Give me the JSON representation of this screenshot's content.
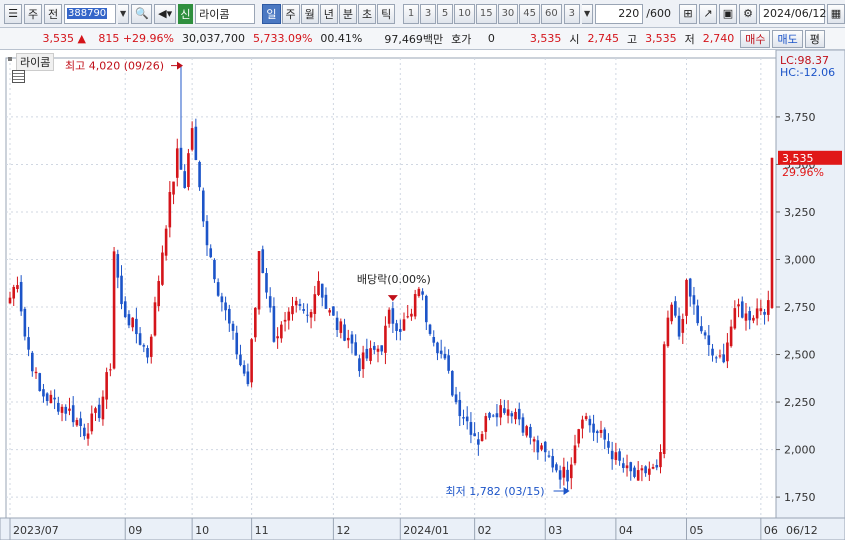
{
  "toolbar": {
    "type_label": "주",
    "mode_label": "전",
    "code": "388790",
    "shin_label": "신",
    "name": "라이콤",
    "periods": [
      "일",
      "주",
      "월",
      "년",
      "분",
      "초",
      "틱"
    ],
    "active_period": "일",
    "intervals": [
      "1",
      "3",
      "5",
      "10",
      "15",
      "30",
      "45",
      "60"
    ],
    "interval_select": "3",
    "count": "220",
    "count_total": "/600",
    "date": "2024/06/12"
  },
  "quote": {
    "price": "3,535",
    "change": "815",
    "change_pct": "+29.96%",
    "volume": "30,037,700",
    "volume_pct": "5,733.09%",
    "turnover": "00.41%",
    "amount": "97,469백만",
    "hoga_label": "호가",
    "hoga_value": "0",
    "hoga_price": "3,535",
    "open_label": "시",
    "open": "2,745",
    "high_label": "고",
    "high": "3,535",
    "low_label": "저",
    "low": "2,740",
    "buy_label": "매수",
    "sell_label": "매도",
    "eval_label": "평"
  },
  "chart_title": "라이콤",
  "chart_data": {
    "type": "candlestick",
    "colors": {
      "up": "#d4141a",
      "down": "#1c54c8",
      "grid": "#d0d7e2",
      "axis_bg": "#eaf0f8"
    },
    "y_ticks": [
      1750,
      2000,
      2250,
      2500,
      2750,
      3000,
      3250,
      3500,
      3750
    ],
    "y_tick_labels": [
      "1,750",
      "2,000",
      "2,250",
      "2,500",
      "2,750",
      "3,000",
      "3,250",
      "3,500",
      "3,750"
    ],
    "ylim": [
      1640,
      4060
    ],
    "x_ticks": [
      {
        "label": "2023/07",
        "index": 0
      },
      {
        "label": "09",
        "index": 31
      },
      {
        "label": "10",
        "index": 49
      },
      {
        "label": "11",
        "index": 65
      },
      {
        "label": "12",
        "index": 87
      },
      {
        "label": "2024/01",
        "index": 105
      },
      {
        "label": "02",
        "index": 125
      },
      {
        "label": "03",
        "index": 144
      },
      {
        "label": "04",
        "index": 163
      },
      {
        "label": "05",
        "index": 182
      },
      {
        "label": "06",
        "index": 202
      }
    ],
    "axis_date_label": "06/12",
    "last_price_label": "3,535",
    "last_pct_label": "29.96%",
    "lc_label": "LC:98.37",
    "hc_label": "HC:-12.06",
    "annotations": {
      "high": {
        "text": "최고 4,020 (09/26)",
        "index": 46,
        "value": 4020
      },
      "low": {
        "text": "최저 1,782 (03/15)",
        "index": 150,
        "value": 1782
      },
      "dividend": {
        "text": "배당락(0.00%)",
        "index": 103,
        "value": 2760
      }
    },
    "anchors": [
      [
        0,
        2800
      ],
      [
        2,
        2900
      ],
      [
        4,
        2600
      ],
      [
        8,
        2300
      ],
      [
        12,
        2250
      ],
      [
        16,
        2200
      ],
      [
        20,
        2100
      ],
      [
        24,
        2200
      ],
      [
        27,
        2450
      ],
      [
        28,
        3050
      ],
      [
        30,
        2750
      ],
      [
        33,
        2650
      ],
      [
        37,
        2500
      ],
      [
        39,
        2750
      ],
      [
        42,
        3200
      ],
      [
        45,
        3550
      ],
      [
        47,
        3400
      ],
      [
        49,
        3700
      ],
      [
        50,
        3500
      ],
      [
        53,
        3100
      ],
      [
        56,
        2850
      ],
      [
        59,
        2650
      ],
      [
        62,
        2450
      ],
      [
        64,
        2350
      ],
      [
        66,
        2750
      ],
      [
        67,
        3050
      ],
      [
        69,
        2850
      ],
      [
        71,
        2600
      ],
      [
        74,
        2650
      ],
      [
        77,
        2750
      ],
      [
        80,
        2700
      ],
      [
        83,
        2900
      ],
      [
        85,
        2750
      ],
      [
        88,
        2650
      ],
      [
        91,
        2600
      ],
      [
        94,
        2450
      ],
      [
        97,
        2500
      ],
      [
        100,
        2550
      ],
      [
        102,
        2700
      ],
      [
        105,
        2650
      ],
      [
        108,
        2700
      ],
      [
        110,
        2870
      ],
      [
        112,
        2700
      ],
      [
        114,
        2600
      ],
      [
        117,
        2450
      ],
      [
        120,
        2250
      ],
      [
        123,
        2150
      ],
      [
        126,
        2050
      ],
      [
        129,
        2200
      ],
      [
        133,
        2230
      ],
      [
        136,
        2200
      ],
      [
        139,
        2100
      ],
      [
        142,
        2000
      ],
      [
        145,
        1950
      ],
      [
        148,
        1880
      ],
      [
        150,
        1870
      ],
      [
        152,
        2050
      ],
      [
        154,
        2200
      ],
      [
        157,
        2100
      ],
      [
        160,
        2050
      ],
      [
        163,
        1950
      ],
      [
        166,
        1880
      ],
      [
        169,
        1850
      ],
      [
        172,
        1900
      ],
      [
        174,
        1880
      ],
      [
        175,
        1950
      ],
      [
        176,
        2550
      ],
      [
        178,
        2750
      ],
      [
        180,
        2600
      ],
      [
        182,
        2850
      ],
      [
        184,
        2750
      ],
      [
        186,
        2600
      ],
      [
        188,
        2550
      ],
      [
        190,
        2450
      ],
      [
        192,
        2500
      ],
      [
        194,
        2650
      ],
      [
        196,
        2750
      ],
      [
        198,
        2700
      ],
      [
        200,
        2720
      ],
      [
        202,
        2760
      ],
      [
        204,
        2745
      ],
      [
        205,
        3535
      ]
    ]
  }
}
